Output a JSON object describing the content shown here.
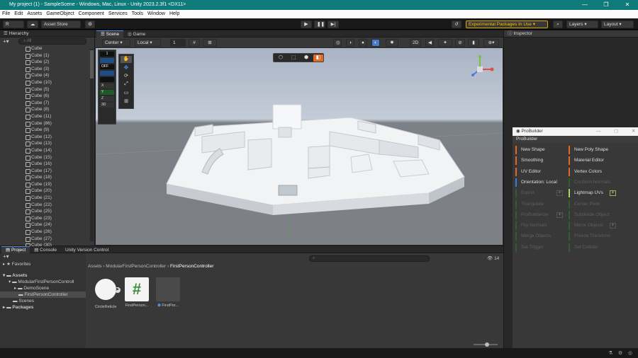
{
  "window": {
    "title": "My project (1) - SampleScene - Windows, Mac, Linux - Unity 2023.2.3f1 <DX11>",
    "controls": [
      "—",
      "❐",
      "✕"
    ]
  },
  "menu": [
    "File",
    "Edit",
    "Assets",
    "GameObject",
    "Component",
    "Services",
    "Tools",
    "Window",
    "Help"
  ],
  "toolbar": {
    "account": "R",
    "asset_store": "Asset Store",
    "experimental": "Experimental Packages In Use",
    "layers": "Layers",
    "layout": "Layout"
  },
  "hierarchy": {
    "title": "Hierarchy",
    "search_placeholder": "All",
    "items": [
      "Cube",
      "Cube (1)",
      "Cube (2)",
      "Cube (3)",
      "Cube (4)",
      "Cube (10)",
      "Cube (5)",
      "Cube (6)",
      "Cube (7)",
      "Cube (8)",
      "Cube (11)",
      "Cube (86)",
      "Cube (9)",
      "Cube (12)",
      "Cube (13)",
      "Cube (14)",
      "Cube (15)",
      "Cube (16)",
      "Cube (17)",
      "Cube (18)",
      "Cube (19)",
      "Cube (20)",
      "Cube (21)",
      "Cube (22)",
      "Cube (25)",
      "Cube (23)",
      "Cube (24)",
      "Cube (26)",
      "Cube (27)",
      "Cube (30)"
    ]
  },
  "scene": {
    "tabs": [
      "Scene",
      "Game"
    ],
    "pivot": "Center",
    "space": "Local",
    "grid_value": "1",
    "mode2d": "2D",
    "overlay": [
      "1",
      "OFF",
      "X",
      "Y",
      "Z",
      "3D"
    ]
  },
  "inspector": {
    "title": "Inspector"
  },
  "probuilder": {
    "window_title": "ProBuilder",
    "header": "ProBuilder",
    "buttons": [
      {
        "label": "New Shape",
        "state": "orange"
      },
      {
        "label": "New Poly Shape",
        "state": "orange"
      },
      {
        "label": "Smoothing",
        "state": "orange"
      },
      {
        "label": "Material Editor",
        "state": "orange"
      },
      {
        "label": "UV Editor",
        "state": "orange"
      },
      {
        "label": "Vertex Colors",
        "state": "orange"
      },
      {
        "label": "Orientation: Local",
        "state": "blue"
      },
      {
        "label": "Conform Normals",
        "state": "dis"
      },
      {
        "label": "Export",
        "state": "dis"
      },
      {
        "label": "Lightmap UVs",
        "state": "lime"
      },
      {
        "label": "Triangulate",
        "state": "dis"
      },
      {
        "label": "Center Pivot",
        "state": "dis"
      },
      {
        "label": "ProBuilderize",
        "state": "dis"
      },
      {
        "label": "Subdivide Object",
        "state": "dis"
      },
      {
        "label": "Flip Normals",
        "state": "dis"
      },
      {
        "label": "Mirror Objects",
        "state": "dis"
      },
      {
        "label": "Merge Objects",
        "state": "dis"
      },
      {
        "label": "Freeze Transform",
        "state": "dis"
      },
      {
        "label": "Set Trigger",
        "state": "dis"
      },
      {
        "label": "Set Collider",
        "state": "dis"
      }
    ]
  },
  "bottom": {
    "tabs": [
      "Project",
      "Console",
      "Unity Version Control"
    ],
    "favorites": "Favorites",
    "assets_root": "Assets",
    "tree": [
      "ModularFirstPersonControll",
      "DemoScene",
      "FirstPersonController",
      "Scenes"
    ],
    "packages": "Packages",
    "breadcrumb": [
      "Assets",
      "ModularFirstPersonController",
      "FirstPersonController"
    ],
    "badge_count": "14",
    "assets": [
      {
        "label": "CircleReticle"
      },
      {
        "label": "FirstPerson..."
      },
      {
        "label": "FirstPer..."
      }
    ]
  }
}
